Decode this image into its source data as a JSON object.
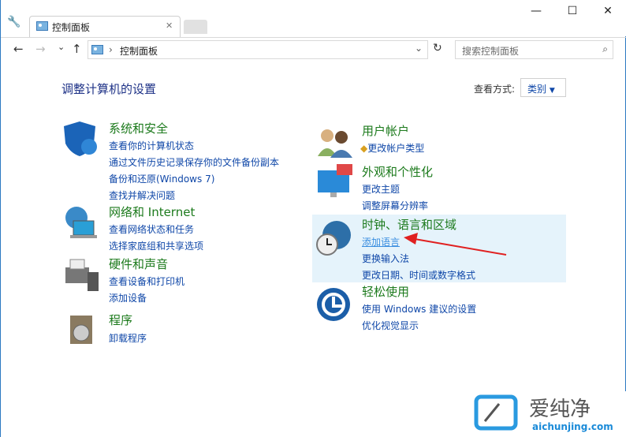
{
  "window": {
    "tab_title": "控制面板",
    "minimize": "—",
    "maximize": "☐",
    "close": "✕",
    "tab_close": "✕"
  },
  "nav": {
    "back": "←",
    "forward": "→",
    "recent": "⌄",
    "up": "↑",
    "breadcrumb_sep": "›",
    "breadcrumb": "控制面板",
    "dropdown": "⌄",
    "refresh": "↻"
  },
  "search": {
    "placeholder": "搜索控制面板"
  },
  "page": {
    "heading": "调整计算机的设置",
    "view_by_label": "查看方式:",
    "view_by_value": "类别"
  },
  "categories": [
    {
      "title": "系统和安全",
      "links": [
        "查看你的计算机状态",
        "通过文件历史记录保存你的文件备份副本",
        "备份和还原(Windows 7)",
        "查找并解决问题"
      ]
    },
    {
      "title": "网络和 Internet",
      "links": [
        "查看网络状态和任务",
        "选择家庭组和共享选项"
      ]
    },
    {
      "title": "硬件和声音",
      "links": [
        "查看设备和打印机",
        "添加设备"
      ]
    },
    {
      "title": "程序",
      "links": [
        "卸载程序"
      ]
    },
    {
      "title": "用户帐户",
      "links": [
        "更改帐户类型"
      ]
    },
    {
      "title": "外观和个性化",
      "links": [
        "更改主题",
        "调整屏幕分辨率"
      ]
    },
    {
      "title": "时钟、语言和区域",
      "links": [
        "添加语言",
        "更换输入法",
        "更改日期、时间或数字格式"
      ]
    },
    {
      "title": "轻松使用",
      "links": [
        "使用 Windows 建议的设置",
        "优化视觉显示"
      ]
    }
  ],
  "watermark": {
    "cn": "爱纯净",
    "url": "aichunjing.com"
  },
  "colors": {
    "accent": "#1c7a1c",
    "link": "#0f47a8",
    "highlight": "#e5f3fb",
    "arrow": "#e02020"
  }
}
